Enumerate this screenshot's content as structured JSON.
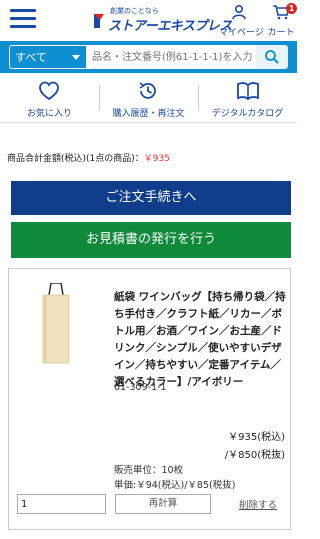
{
  "header": {
    "logo_tagline": "創業のことなら",
    "logo_text": "ストアーエキスプレス",
    "mypage_label": "マイページ",
    "cart_label": "カート",
    "cart_count": "1",
    "brand_color": "#1a4aa8"
  },
  "search": {
    "category": "すべて",
    "placeholder": "品名・注文番号(例61-1-1-1)を入力"
  },
  "shortcuts": [
    {
      "label": "お気に入り",
      "icon": "heart-icon"
    },
    {
      "label": "購入履歴・再注文",
      "icon": "history-icon"
    },
    {
      "label": "デジタルカタログ",
      "icon": "book-icon"
    }
  ],
  "summary": {
    "label": "商品合計金額(税込)(1点の商品)：",
    "price": "￥935"
  },
  "actions": {
    "order_label": "ご注文手続きへ",
    "quote_label": "お見積書の発行を行う"
  },
  "item": {
    "name": "紙袋 ワインバッグ【持ち帰り袋／持ち手付き／クラフト紙／リカー／ボトル用／お酒／ワイン／お土産／ドリンク／シンプル／使いやすいデザイン／持ちやすい／定番アイテム／選べるカラー】/アイボリー",
    "code": "61-309-1-1",
    "price_tax": "￥935(税込)",
    "price_notax": "/￥850(税抜)",
    "sales_unit": "販売単位：10枚",
    "unit_price": "単価:￥94(税込)/￥85(税抜)",
    "quantity": "1",
    "recalc_label": "再計算",
    "delete_label": "削除する"
  }
}
